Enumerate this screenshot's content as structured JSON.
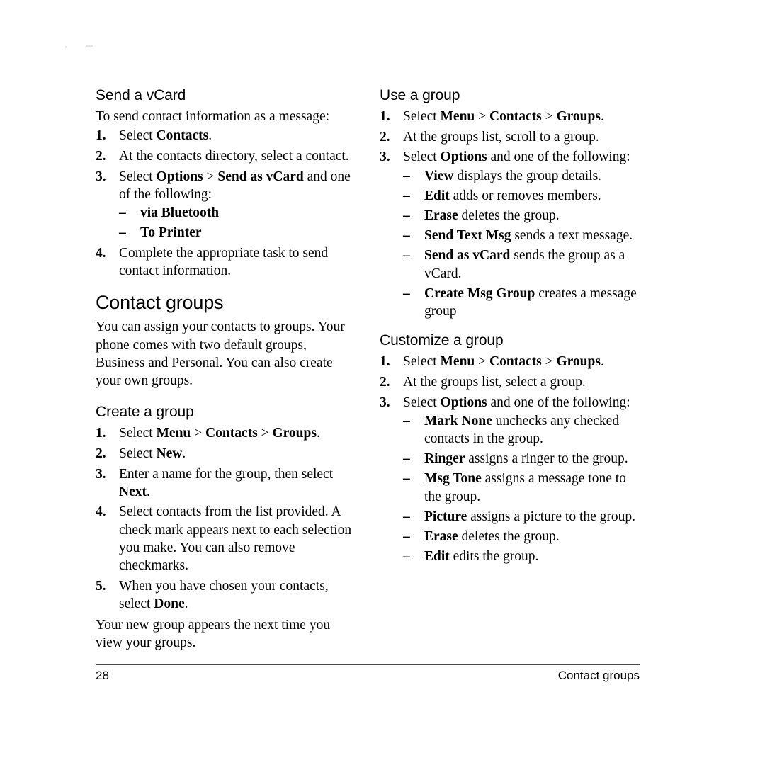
{
  "page": {
    "number": "28",
    "running_head": "Contact groups"
  },
  "left_column": {
    "sections": [
      {
        "id": "send-a-vcard",
        "heading": "Send a vCard",
        "heading_level": "h2",
        "intro": "To send contact information as a message:",
        "steps": [
          {
            "num": "1.",
            "html": "Select <b>Contacts</b>."
          },
          {
            "num": "2.",
            "html": "At the contacts directory, select a contact."
          },
          {
            "num": "3.",
            "html": "Select <b>Options</b> &gt; <b>Send as vCard</b> and one of the following:",
            "dashes": [
              {
                "dash": "–",
                "html": "<b>via Bluetooth</b>"
              },
              {
                "dash": "–",
                "html": "<b>To Printer</b>"
              }
            ]
          },
          {
            "num": "4.",
            "html": "Complete the appropriate task to send contact information."
          }
        ]
      },
      {
        "id": "contact-groups",
        "heading": "Contact groups",
        "heading_level": "h1",
        "paragraph": "You can assign your contacts to groups. Your phone comes with two default groups, Business and Personal. You can also create your own groups."
      },
      {
        "id": "create-a-group",
        "heading": "Create a group",
        "heading_level": "h2",
        "steps": [
          {
            "num": "1.",
            "html": "Select <b>Menu</b> &gt; <b>Contacts</b> &gt; <b>Groups</b>."
          },
          {
            "num": "2.",
            "html": "Select <b>New</b>."
          },
          {
            "num": "3.",
            "html": "Enter a name for the group, then select <b>Next</b>."
          },
          {
            "num": "4.",
            "html": "Select contacts from the list provided. A check mark appears next to each selection you make. You can also remove checkmarks."
          },
          {
            "num": "5.",
            "html": "When you have chosen your contacts, select <b>Done</b>."
          }
        ],
        "closing": "Your new group appears the next time you view your groups."
      }
    ]
  },
  "right_column": {
    "sections": [
      {
        "id": "use-a-group",
        "heading": "Use a group",
        "heading_level": "h2",
        "steps": [
          {
            "num": "1.",
            "html": "Select <b>Menu</b> &gt; <b>Contacts</b> &gt; <b>Groups</b>."
          },
          {
            "num": "2.",
            "html": "At the groups list, scroll to a group."
          },
          {
            "num": "3.",
            "html": "Select <b>Options</b> and one of the following:",
            "dashes": [
              {
                "dash": "–",
                "html": "<b>View</b> displays the group details."
              },
              {
                "dash": "–",
                "html": "<b>Edit</b> adds or removes members."
              },
              {
                "dash": "–",
                "html": "<b>Erase</b> deletes the group."
              },
              {
                "dash": "–",
                "html": "<b>Send Text Msg</b> sends a text message."
              },
              {
                "dash": "–",
                "html": "<b>Send as vCard</b> sends the group as a vCard."
              },
              {
                "dash": "–",
                "html": "<b>Create Msg Group</b> creates a message group"
              }
            ]
          }
        ]
      },
      {
        "id": "customize-a-group",
        "heading": "Customize a group",
        "heading_level": "h2",
        "steps": [
          {
            "num": "1.",
            "html": "Select <b>Menu</b> &gt; <b>Contacts</b> &gt; <b>Groups</b>."
          },
          {
            "num": "2.",
            "html": "At the groups list, select a group."
          },
          {
            "num": "3.",
            "html": "Select <b>Options</b> and one of the following:",
            "dashes": [
              {
                "dash": "–",
                "html": "<b>Mark None</b> unchecks any checked contacts in the group."
              },
              {
                "dash": "–",
                "html": "<b>Ringer</b> assigns a ringer to the group."
              },
              {
                "dash": "–",
                "html": "<b>Msg Tone</b> assigns a message tone to the group."
              },
              {
                "dash": "–",
                "html": "<b>Picture</b> assigns a picture to the group."
              },
              {
                "dash": "–",
                "html": "<b>Erase</b> deletes the group."
              },
              {
                "dash": "–",
                "html": "<b>Edit</b> edits the group."
              }
            ]
          }
        ]
      }
    ]
  },
  "colors": {
    "page_background": "#ffffff",
    "text": "#000000",
    "footer_rule": "#4a4a4a"
  }
}
